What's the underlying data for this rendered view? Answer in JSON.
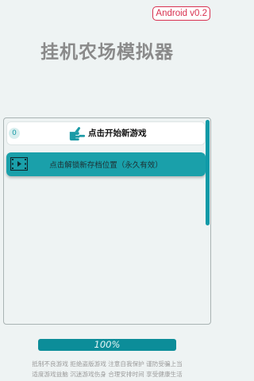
{
  "version": "Android v0.2",
  "title": "挂机农场模拟器",
  "slots": {
    "new_game": {
      "index": "0",
      "label": "点击开始新游戏",
      "icon": "pointing-hand-icon"
    },
    "unlock": {
      "label": "点击解锁新存档位置（永久有效）",
      "icon": "film-strip-icon"
    }
  },
  "progress": {
    "label": "100%",
    "value": 100
  },
  "notice": {
    "line1": "抵制不良游戏 拒绝盗版游戏 注意自我保护 谨防受骗上当",
    "line2": "适度游戏益脑 沉迷游戏伤身 合理安排时间 享受健康生活"
  },
  "colors": {
    "accent": "#0e9aa7",
    "badge": "#d8304f",
    "background": "#eef3f3"
  }
}
